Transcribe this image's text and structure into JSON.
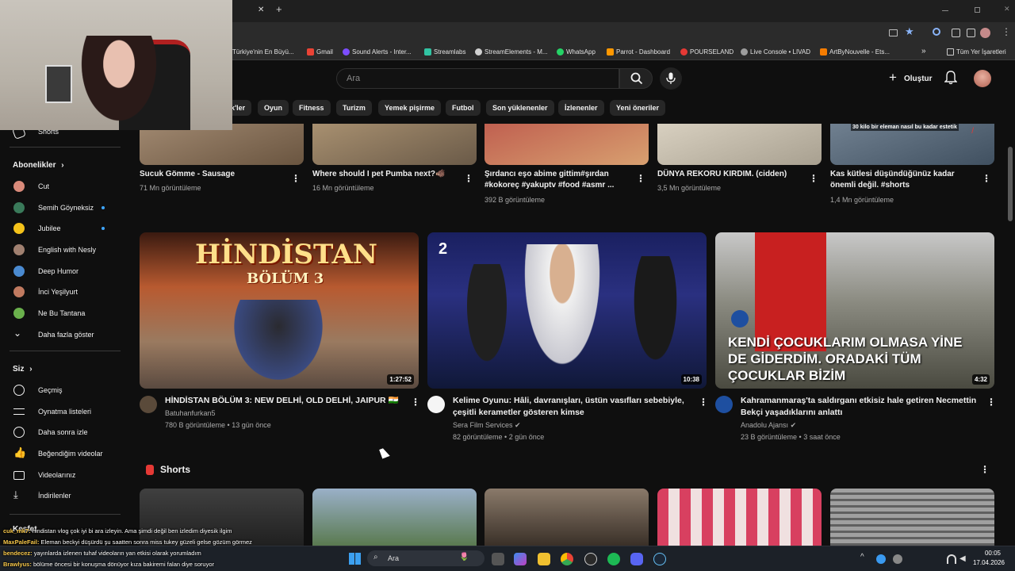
{
  "browser": {
    "bookmarks": [
      {
        "label": "Türkiye'nin En Büyü...",
        "color": "#e53935"
      },
      {
        "label": "Gmail",
        "color": "#ea4335"
      },
      {
        "label": "Sound Alerts - Inter...",
        "color": "#7c4dff"
      },
      {
        "label": "Streamlabs",
        "color": "#31c3a2"
      },
      {
        "label": "StreamElements - M...",
        "color": "#d0d0d0"
      },
      {
        "label": "WhatsApp",
        "color": "#25d366"
      },
      {
        "label": "Parrot - Dashboard",
        "color": "#ff9800"
      },
      {
        "label": "POURSELAND",
        "color": "#e53935"
      },
      {
        "label": "Live Console • LIVAD",
        "color": "#9e9e9e"
      },
      {
        "label": "ArtByNouvelle - Ets...",
        "color": "#f57c00"
      }
    ],
    "more_bookmarks": "»",
    "all_bookmarks": "Tüm Yer İşaretleri",
    "tab_close": "✕",
    "new_tab": "+"
  },
  "header": {
    "search_placeholder": "Ara",
    "create_label": "Oluştur"
  },
  "chips": [
    "k'ler",
    "Oyun",
    "Fitness",
    "Turizm",
    "Yemek pişirme",
    "Futbol",
    "Son yüklenenler",
    "İzlenenler",
    "Yeni öneriler"
  ],
  "sidebar": {
    "shorts": "Shorts",
    "subscriptions_title": "Abonelikler",
    "subscriptions": [
      {
        "label": "Cut",
        "color": "#d98a7a",
        "dot": false
      },
      {
        "label": "Semih Göyneksiz",
        "color": "#3a7a5a",
        "dot": true
      },
      {
        "label": "Jubilee",
        "color": "#f4c21a",
        "dot": true
      },
      {
        "label": "English with Nesly",
        "color": "#a08070",
        "dot": false
      },
      {
        "label": "Deep Humor",
        "color": "#4a8ad0",
        "dot": false
      },
      {
        "label": "İnci Yeşilyurt",
        "color": "#c07a60",
        "dot": false
      },
      {
        "label": "Ne Bu Tantana",
        "color": "#6ab04c",
        "dot": false
      }
    ],
    "show_more": "Daha fazla göster",
    "you_title": "Siz",
    "you_items": [
      {
        "label": "Geçmiş",
        "icon": "history-icon"
      },
      {
        "label": "Oynatma listeleri",
        "icon": "playlists-icon"
      },
      {
        "label": "Daha sonra izle",
        "icon": "watch-later-icon"
      },
      {
        "label": "Beğendiğim videolar",
        "icon": "like-icon"
      },
      {
        "label": "Videolarınız",
        "icon": "your-videos-icon"
      },
      {
        "label": "İndirilenler",
        "icon": "downloads-icon"
      }
    ],
    "keşfet": "Keşfet"
  },
  "top_shorts": [
    {
      "title": "Sucuk Gömme - Sausage",
      "views": "71 Mn görüntüleme"
    },
    {
      "title": "Where should I pet Pumba next?🐗",
      "views": "16 Mn görüntüleme"
    },
    {
      "title": "Şırdancı eşo abime gittim#şırdan #kokoreç #yakuptv #food #asmr ...",
      "views": "392 B görüntüleme"
    },
    {
      "title": "DÜNYA REKORU KIRDIM. (cidden)",
      "views": "3,5 Mn görüntüleme"
    },
    {
      "title": "Kas kütlesi düşündüğünüz kadar önemli değil. #shorts",
      "views": "1,4 Mn görüntüleme",
      "overlay": "30 kilo bir eleman nasıl bu kadar estetik"
    }
  ],
  "videos": [
    {
      "title": "HİNDİSTAN BÖLÜM 3: NEW DELHİ, OLD DELHİ, JAIPUR 🇮🇳",
      "channel": "Batuhanfurkan5",
      "meta": "780 B görüntüleme • 13 gün önce",
      "duration": "1:27:52",
      "thumb_text_1": "HİNDİSTAN",
      "thumb_text_2": "BÖLÜM 3"
    },
    {
      "title": "Kelime Oyunu: Hâli, davranışları, üstün vasıfları sebebiyle, çeşitli kerametler gösteren kimse",
      "channel": "Sera Film Services",
      "meta": "82 görüntüleme • 2 gün önce",
      "duration": "10:38",
      "badge": "2"
    },
    {
      "title": "Kahramanmaraş'ta saldırganı etkisiz hale getiren Necmettin Bekçi yaşadıklarını anlattı",
      "channel": "Anadolu Ajansı",
      "meta": "23 B görüntüleme • 3 saat önce",
      "duration": "4:32",
      "thumb_text": "KENDİ ÇOCUKLARIM OLMASA YİNE DE GİDERDİM. ORADAKİ TÜM ÇOCUKLAR BİZİM"
    }
  ],
  "shorts_section_title": "Shorts",
  "chat": [
    {
      "user": "cuk_mk7:",
      "text": "hindistan vlog çok iyi bi ara izleyin. Ama şimdi değil ben izledim diyesik ilgim"
    },
    {
      "user": "MaxPaleFail:",
      "text": "Eleman beckyi düşürdü şu saatten sonra miss tukey güzeli gelse gözüm görmez"
    },
    {
      "user": "bendecez:",
      "text": "yayınlarda izlenen tuhaf videoların yan etkisi olarak yorumladım"
    },
    {
      "user": "Brawlyus:",
      "text": "bölüme öncesi bir konuşma dönüyor kıza bakiremi falan diye soruyor"
    }
  ],
  "taskbar": {
    "search": "Ara",
    "time": "00:05",
    "date": "17.04.2026"
  }
}
